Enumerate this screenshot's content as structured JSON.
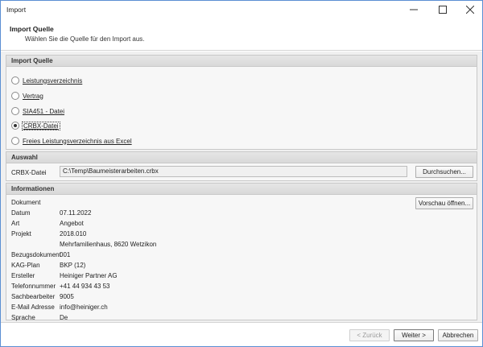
{
  "window": {
    "title": "Import"
  },
  "header": {
    "title": "Import Quelle",
    "subtitle": "Wählen Sie die Quelle für den Import aus."
  },
  "source_group": {
    "title": "Import Quelle",
    "options": [
      {
        "label": "Leistungsverzeichnis",
        "checked": false
      },
      {
        "label": "Vertrag",
        "checked": false
      },
      {
        "label": "SIA451 - Datei",
        "checked": false
      },
      {
        "label": "CRBX-Datei",
        "checked": true
      },
      {
        "label": "Freies Leistungsverzeichnis aus Excel",
        "checked": false
      }
    ]
  },
  "selection_group": {
    "title": "Auswahl",
    "field_label": "CRBX-Datei",
    "field_value": "C:\\Temp\\Baumeisterarbeiten.crbx",
    "browse_label": "Durchsuchen..."
  },
  "info_group": {
    "title": "Informationen",
    "preview_label": "Vorschau öffnen...",
    "rows": [
      {
        "label": "Dokument",
        "value": ""
      },
      {
        "label": "Datum",
        "value": "07.11.2022"
      },
      {
        "label": "Art",
        "value": "Angebot"
      },
      {
        "label": "Projekt",
        "value": "2018.010"
      },
      {
        "label": "",
        "value": "Mehrfamilienhaus, 8620 Wetzikon"
      },
      {
        "label": "Bezugsdokument",
        "value": "001"
      },
      {
        "label": "KAG-Plan",
        "value": "BKP (12)"
      },
      {
        "label": "Ersteller",
        "value": "Heiniger  Partner AG"
      },
      {
        "label": "Telefonnummer",
        "value": "+41 44 934 43 53"
      },
      {
        "label": "Sachbearbeiter",
        "value": "9005"
      },
      {
        "label": "E-Mail Adresse",
        "value": "info@heiniger.ch"
      },
      {
        "label": "Sprache",
        "value": "De"
      }
    ]
  },
  "footer": {
    "back_label": "< Zurück",
    "next_label": "Weiter >",
    "cancel_label": "Abbrechen"
  }
}
